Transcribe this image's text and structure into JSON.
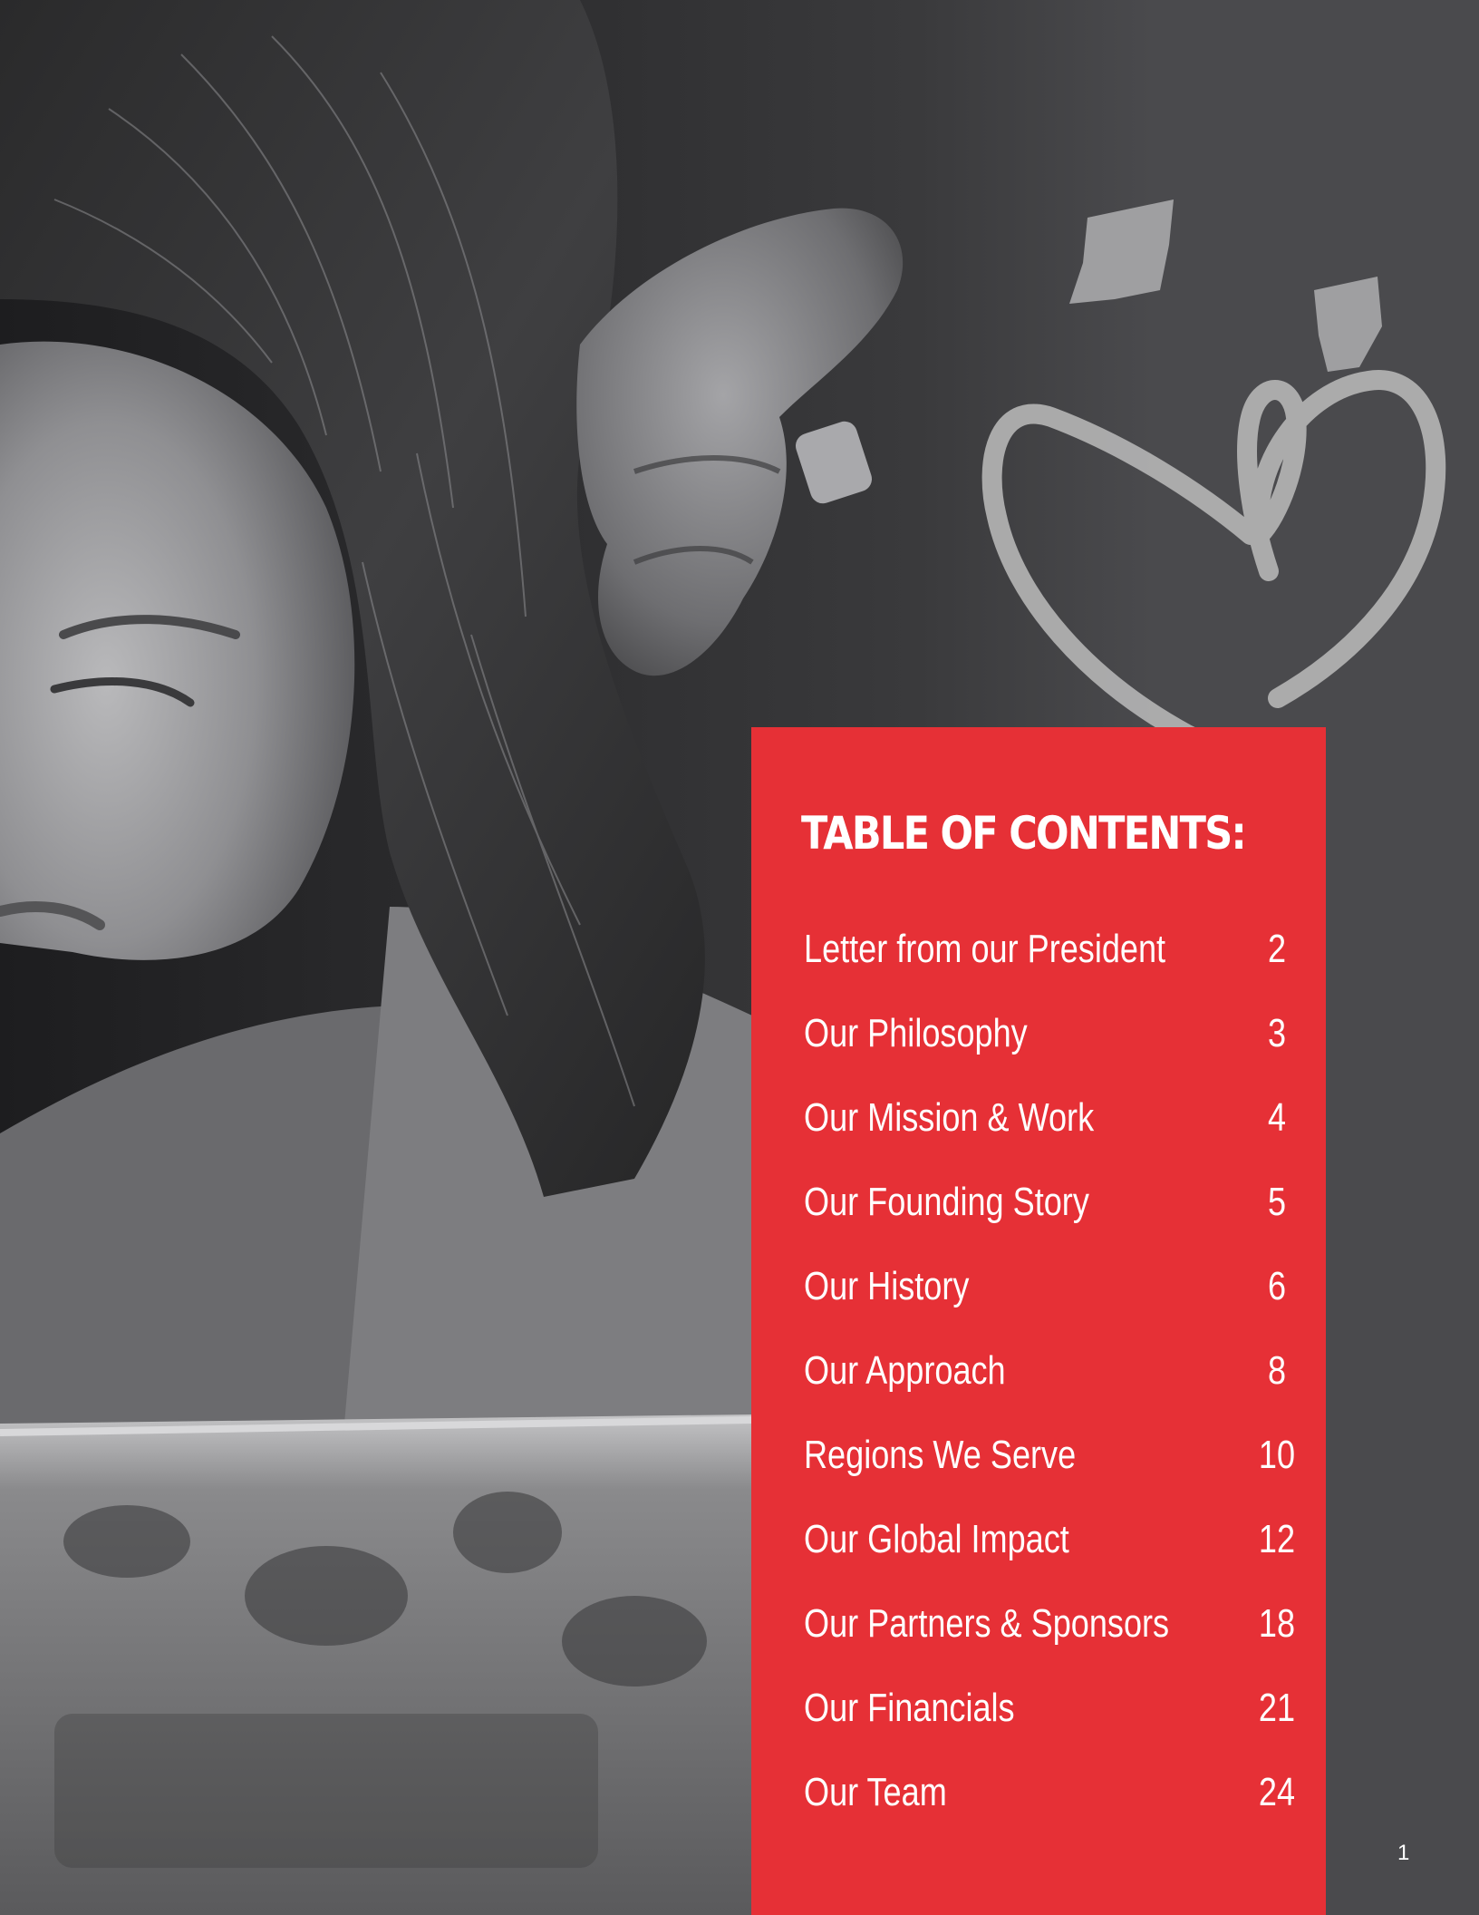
{
  "toc": {
    "title": "TABLE OF CONTENTS:",
    "entries": [
      {
        "label": "Letter from our President",
        "page": "2"
      },
      {
        "label": "Our Philosophy",
        "page": "3"
      },
      {
        "label": "Our Mission & Work",
        "page": "4"
      },
      {
        "label": "Our Founding Story",
        "page": "5"
      },
      {
        "label": "Our History",
        "page": "6"
      },
      {
        "label": "Our Approach",
        "page": "8"
      },
      {
        "label": "Regions We Serve",
        "page": "10"
      },
      {
        "label": "Our Global Impact",
        "page": "12"
      },
      {
        "label": "Our Partners & Sponsors",
        "page": "18"
      },
      {
        "label": "Our Financials",
        "page": "21"
      },
      {
        "label": "Our Team",
        "page": "24"
      }
    ]
  },
  "page_number": "1",
  "colors": {
    "panel_red": "#e63036",
    "background_gray": "#4a4a4d",
    "text_white": "#ffffff",
    "heart_gray": "#b3b3b3"
  },
  "images": {
    "photo": "black-and-white photo of a young girl reading a book while an adult hand touches her hair",
    "heart_logo": "brush-stroke heart icon"
  }
}
